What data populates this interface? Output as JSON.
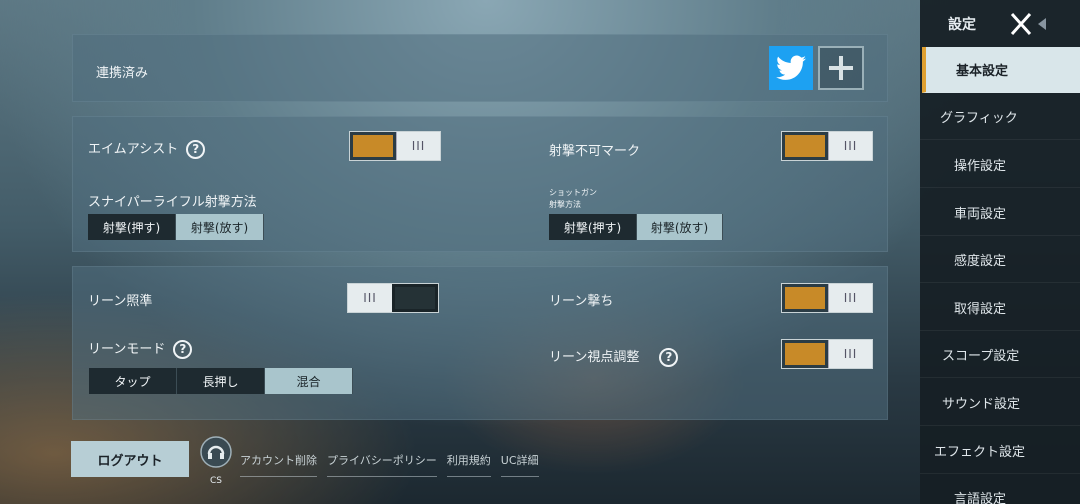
{
  "linked": {
    "label": "連携済み"
  },
  "aim": {
    "aim_assist_label": "エイムアシスト",
    "cannot_fire_label": "射撃不可マーク",
    "sniper_label": "スナイパーライフル射撃方法",
    "shotgun_label_1": "ショットガン",
    "shotgun_label_2": "射撃方法",
    "fire_press": "射撃(押す)",
    "fire_release": "射撃(放す)",
    "knob_glyph": "III",
    "help_glyph": "?"
  },
  "lean": {
    "aim_label": "リーン照準",
    "shoot_label": "リーン撃ち",
    "mode_label": "リーンモード",
    "view_adjust_label": "リーン視点調整",
    "mode_options": [
      "タップ",
      "長押し",
      "混合"
    ],
    "mode_selected": "混合"
  },
  "toggles": {
    "aim_assist": true,
    "cannot_fire_mark": true,
    "lean_aim": false,
    "lean_shoot": true,
    "lean_view_adjust": true
  },
  "sidebar": {
    "title": "設定",
    "items": [
      {
        "label": "基本設定",
        "active": true
      },
      {
        "label": "グラフィック"
      },
      {
        "label": "操作設定"
      },
      {
        "label": "車両設定"
      },
      {
        "label": "感度設定"
      },
      {
        "label": "取得設定"
      },
      {
        "label": "スコープ設定"
      },
      {
        "label": "サウンド設定"
      },
      {
        "label": "エフェクト設定"
      },
      {
        "label": "言語設定"
      }
    ]
  },
  "footer": {
    "logout": "ログアウト",
    "cs": "CS",
    "links": [
      "アカウント削除",
      "プライバシーポリシー",
      "利用規約",
      "UC詳細"
    ]
  },
  "colors": {
    "accent": "#c88a28",
    "twitter": "#1da1f2"
  }
}
